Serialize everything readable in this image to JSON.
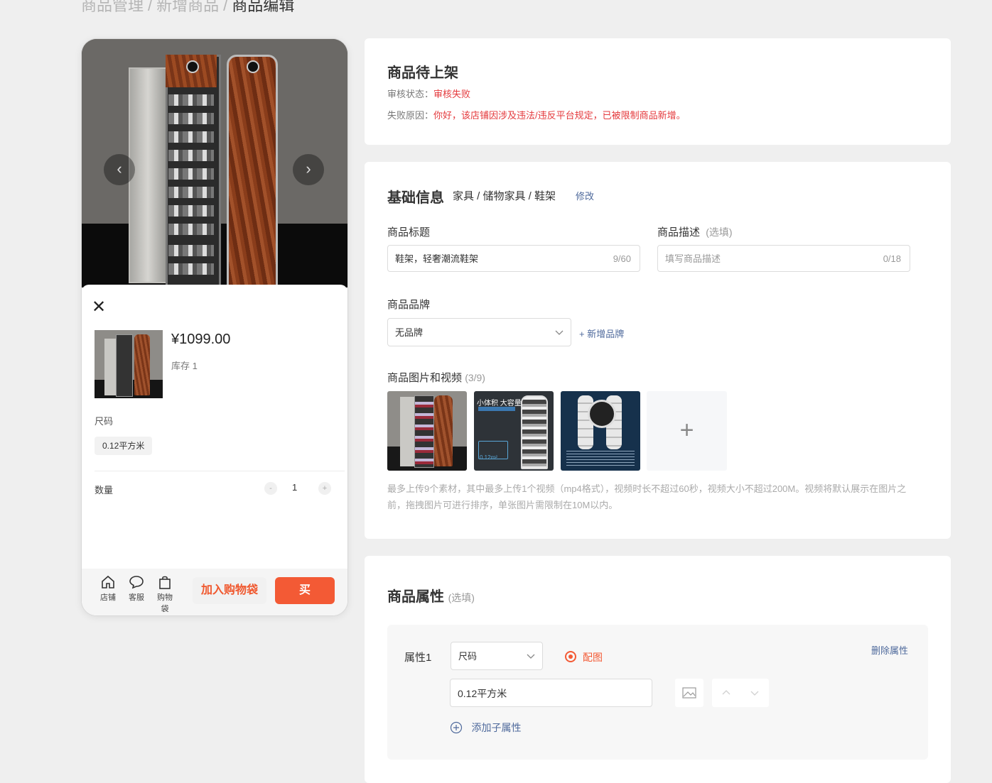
{
  "breadcrumb": [
    "商品管理",
    "新增商品",
    "商品编辑"
  ],
  "preview": {
    "price": "¥1099.00",
    "stock": "库存 1",
    "spec_label": "尺码",
    "spec_chip": "0.12平方米",
    "qty_label": "数量",
    "qty_minus": "-",
    "qty_value": "1",
    "qty_plus": "+",
    "tabs": [
      {
        "label": "店铺",
        "icon": "store-icon"
      },
      {
        "label": "客服",
        "icon": "chat-icon"
      },
      {
        "label": "购物袋",
        "icon": "bag-icon"
      }
    ],
    "add_cart": "加入购物袋",
    "buy": "买"
  },
  "status": {
    "title": "商品待上架",
    "review_label": "审核状态：",
    "review_value": "审核失败",
    "reason_label": "失败原因：",
    "reason_value": "你好，该店铺因涉及违法/违反平台规定，已被限制商品新增。"
  },
  "basic": {
    "title": "基础信息",
    "category": "家具 / 储物家具 / 鞋架",
    "modify": "修改",
    "title_label": "商品标题",
    "title_value": "鞋架，轻奢潮流鞋架",
    "title_count": "9/60",
    "desc_label": "商品描述",
    "desc_optional": "(选填)",
    "desc_placeholder": "填写商品描述",
    "desc_count": "0/18",
    "brand_label": "商品品牌",
    "brand_value": "无品牌",
    "add_brand": "+ 新增品牌",
    "media_label": "商品图片和视频",
    "media_count": "(3/9)",
    "media_thumb2_text": "小体积 大容量",
    "media_thumb2_size": "0.12m²",
    "media_note": "最多上传9个素材，其中最多上传1个视频（mp4格式），视频时长不超过60秒，视频大小不超过200M。视频将默认展示在图片之前，拖拽图片可进行排序，单张图片需限制在10M以内。"
  },
  "attrs": {
    "title": "商品属性",
    "optional": "(选填)",
    "attr_label": "属性1",
    "attr_select": "尺码",
    "with_image": "配图",
    "delete": "删除属性",
    "value": "0.12平方米",
    "add_sub": "添加子属性"
  },
  "colors": {
    "accent": "#f35a35",
    "error": "#e4393c",
    "link": "#4f6a9c"
  }
}
